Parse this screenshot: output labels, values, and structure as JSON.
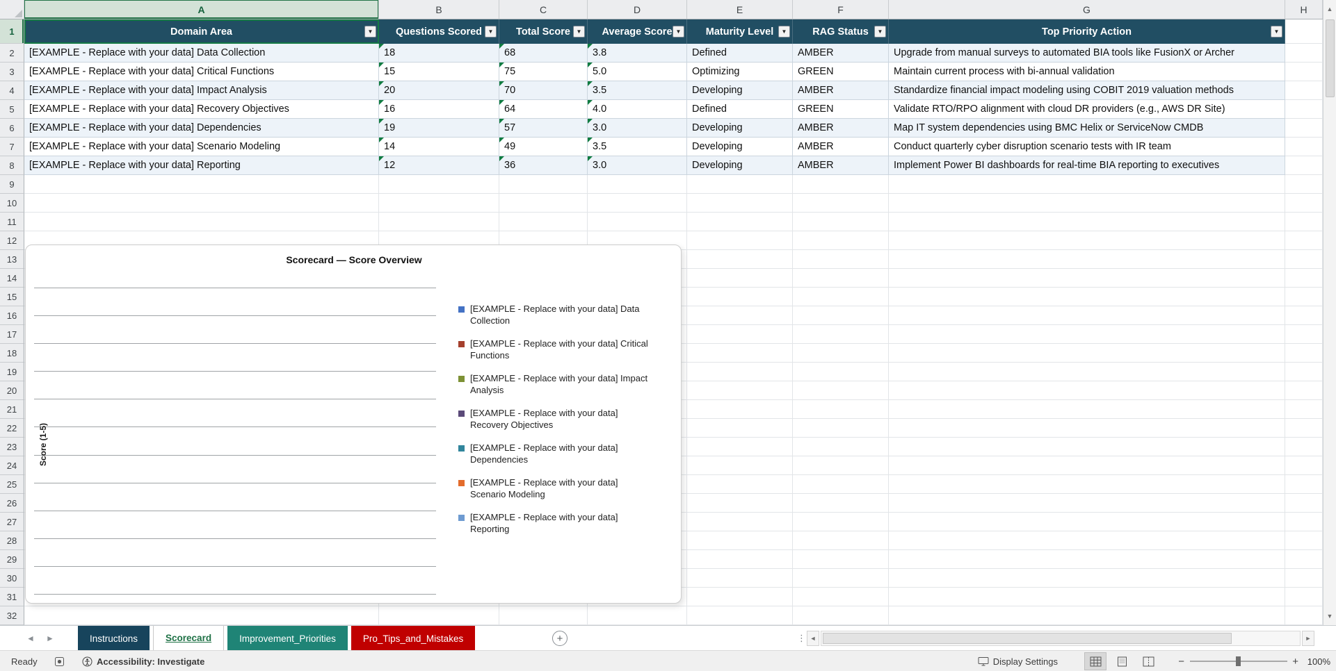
{
  "window": {
    "kind": "Excel worksheet — Scorecard"
  },
  "icons": {
    "filter_arrow": "▼",
    "sheet_nav_left": "◄",
    "sheet_nav_right": "►",
    "scroll_up": "▲",
    "scroll_down": "▼",
    "scroll_left": "◄",
    "scroll_right": "►",
    "add_sheet": "+",
    "tab_strip_handle": "⋮",
    "zoom_out": "−",
    "zoom_in": "+",
    "select_all_corner": "corner-triangle",
    "record_macro": "svg-shape",
    "accessibility_person": "svg-shape",
    "display_settings_monitor": "svg-shape",
    "view_normal": "svg-grid",
    "view_page_layout": "svg-page",
    "view_page_break": "svg-page-dashed",
    "error_flag": "green-corner-triangle"
  },
  "grid": {
    "column_letters": [
      "A",
      "B",
      "C",
      "D",
      "E",
      "F",
      "G",
      "H"
    ],
    "row_first": 1,
    "row_last": 32,
    "active_cell": "A1"
  },
  "table": {
    "headers": [
      "Domain Area",
      "Questions Scored",
      "Total Score",
      "Average Score",
      "Maturity Level",
      "RAG Status",
      "Top Priority Action"
    ],
    "rows": [
      [
        "[EXAMPLE - Replace with your data] Data Collection",
        "18",
        "68",
        "3.8",
        "Defined",
        "AMBER",
        "Upgrade from manual surveys to automated BIA tools like FusionX or Archer"
      ],
      [
        "[EXAMPLE - Replace with your data] Critical Functions",
        "15",
        "75",
        "5.0",
        "Optimizing",
        "GREEN",
        "Maintain current process with bi-annual validation"
      ],
      [
        "[EXAMPLE - Replace with your data] Impact Analysis",
        "20",
        "70",
        "3.5",
        "Developing",
        "AMBER",
        "Standardize financial impact modeling using COBIT 2019 valuation methods"
      ],
      [
        "[EXAMPLE - Replace with your data] Recovery Objectives",
        "16",
        "64",
        "4.0",
        "Defined",
        "GREEN",
        "Validate RTO/RPO alignment with cloud DR providers (e.g., AWS DR Site)"
      ],
      [
        "[EXAMPLE - Replace with your data] Dependencies",
        "19",
        "57",
        "3.0",
        "Developing",
        "AMBER",
        "Map IT system dependencies using BMC Helix or ServiceNow CMDB"
      ],
      [
        "[EXAMPLE - Replace with your data] Scenario Modeling",
        "14",
        "49",
        "3.5",
        "Developing",
        "AMBER",
        "Conduct quarterly cyber disruption scenario tests with IR team"
      ],
      [
        "[EXAMPLE - Replace with your data] Reporting",
        "12",
        "36",
        "3.0",
        "Developing",
        "AMBER",
        "Implement Power BI dashboards for real-time BIA reporting to executives"
      ]
    ],
    "flagged_columns": [
      "B",
      "C",
      "D"
    ]
  },
  "chart_data": {
    "type": "bar",
    "title": "Scorecard — Score Overview",
    "ylabel": "Score (1-5)",
    "legend_position": "right",
    "gridlines": 12,
    "plot_values_visible": false,
    "y_tick_labels_visible": false,
    "series": [
      {
        "name": "[EXAMPLE - Replace with your data] Data Collection",
        "color": "#4472C4",
        "values": []
      },
      {
        "name": "[EXAMPLE - Replace with your data] Critical Functions",
        "color": "#A5402D",
        "values": []
      },
      {
        "name": "[EXAMPLE - Replace with your data] Impact Analysis",
        "color": "#7D9135",
        "values": []
      },
      {
        "name": "[EXAMPLE - Replace with your data] Recovery Objectives",
        "color": "#5B4A79",
        "values": []
      },
      {
        "name": "[EXAMPLE - Replace with your data] Dependencies",
        "color": "#31859C",
        "values": []
      },
      {
        "name": "[EXAMPLE - Replace with your data] Scenario Modeling",
        "color": "#E36C2C",
        "values": []
      },
      {
        "name": "[EXAMPLE - Replace with your data] Reporting",
        "color": "#6E9BD1",
        "values": []
      }
    ]
  },
  "sheet_tabs": {
    "add_label": "+",
    "tabs": [
      {
        "label": "Instructions",
        "fill": "#17445C",
        "text_color": "#FFFFFF",
        "active": false
      },
      {
        "label": "Scorecard",
        "fill": "#FFFFFF",
        "text_color": "#1E7145",
        "active": true
      },
      {
        "label": "Improvement_Priorities",
        "fill": "#1F8476",
        "text_color": "#FFFFFF",
        "active": false
      },
      {
        "label": "Pro_Tips_and_Mistakes",
        "fill": "#C00000",
        "text_color": "#FFFFFF",
        "active": false
      }
    ]
  },
  "status_bar": {
    "ready_label": "Ready",
    "accessibility_label": "Accessibility: Investigate",
    "display_settings_label": "Display Settings",
    "zoom_label": "100%"
  },
  "colors": {
    "header_fill": "#214E63",
    "band_fill": "#EDF3F9",
    "table_border": "#CBD5DE",
    "grid_line": "#E2E5E8",
    "flag_green": "#107C41",
    "selection_green": "#157A45"
  }
}
